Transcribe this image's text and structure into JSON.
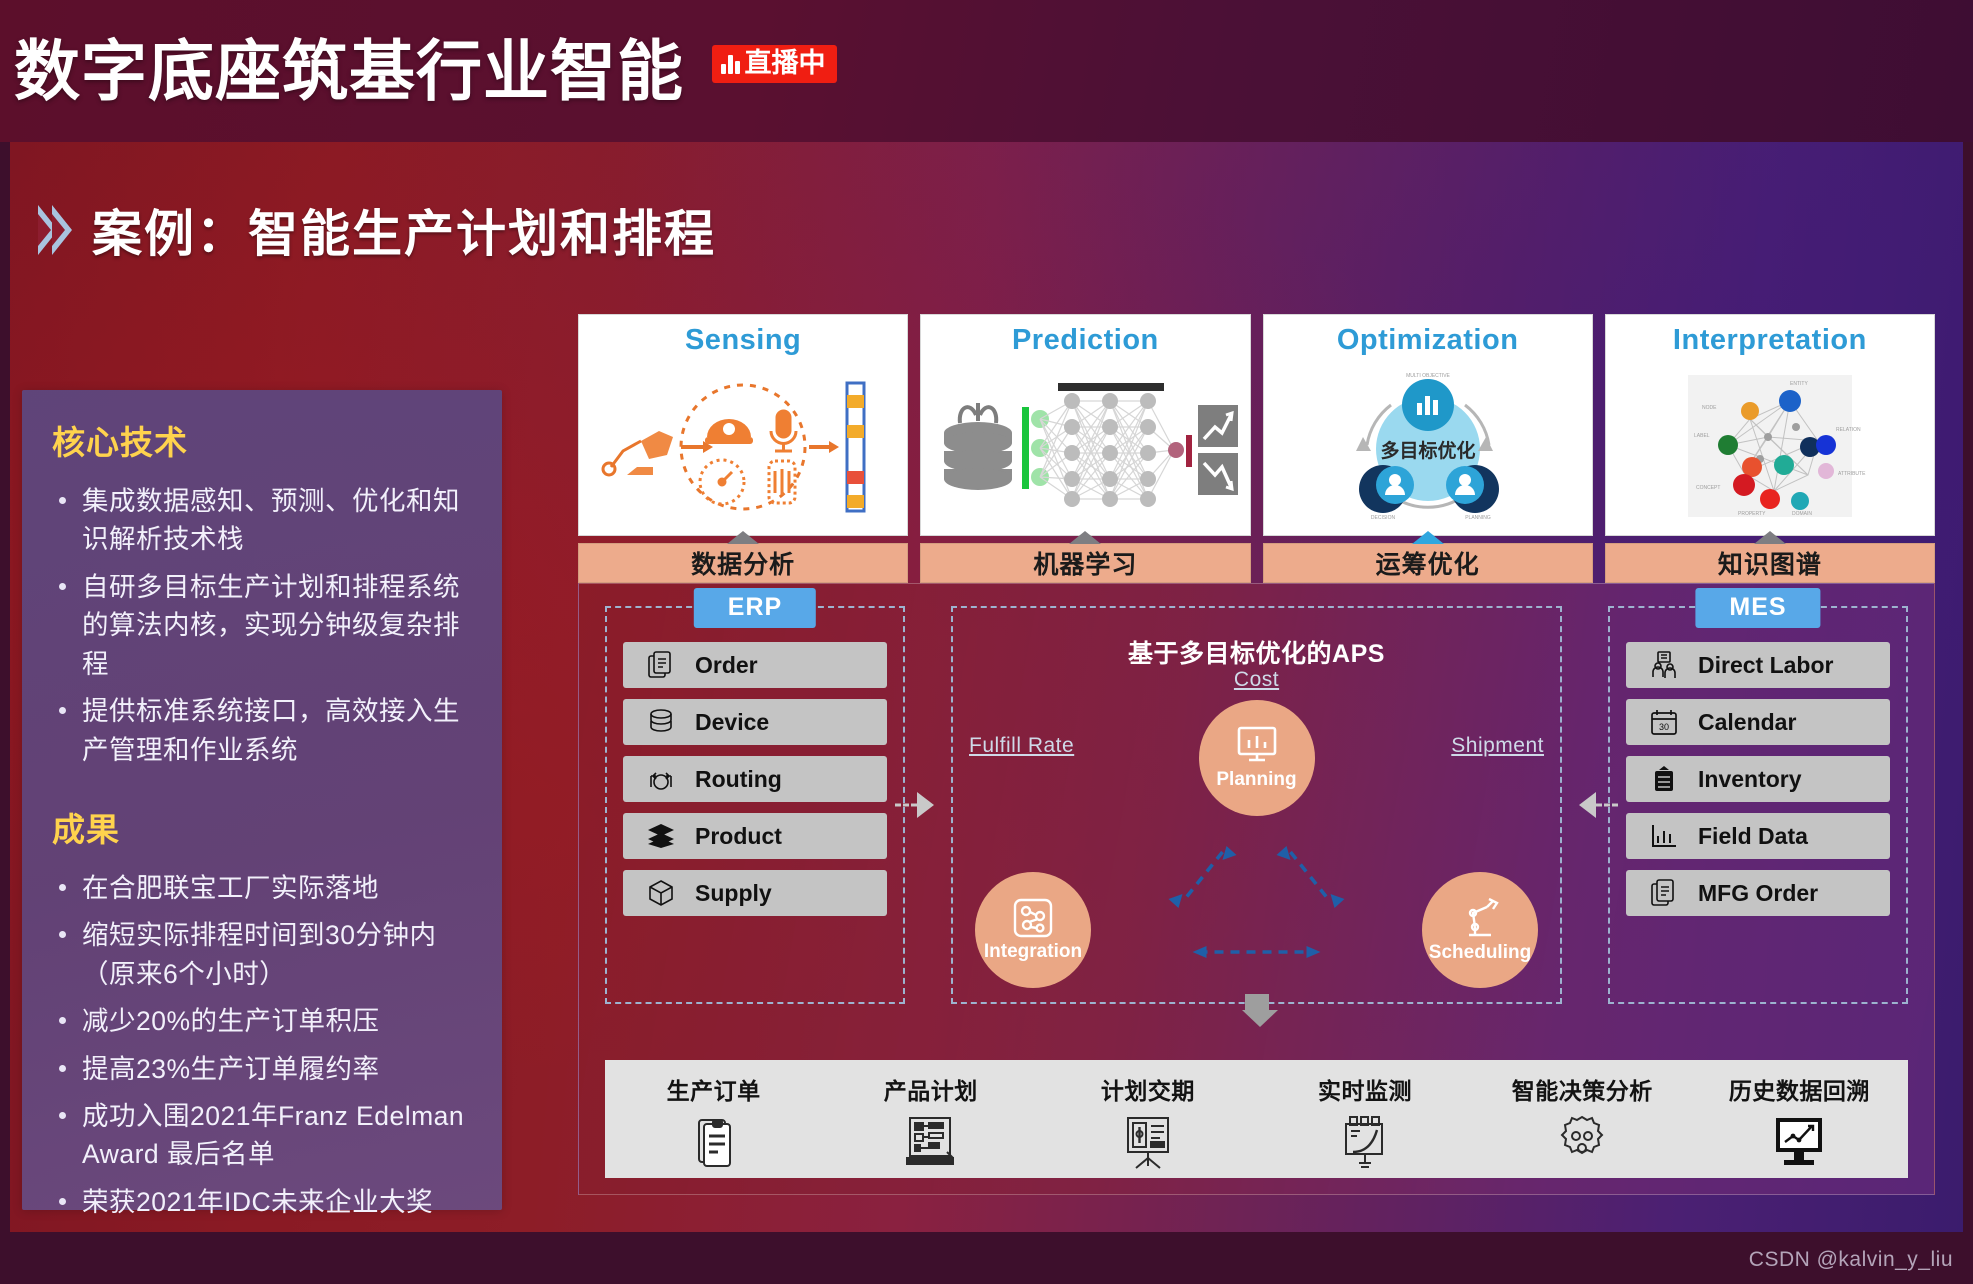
{
  "header": {
    "title": "数字底座筑基行业智能",
    "live_badge": "直播中",
    "live_badge_color": "#f01e12"
  },
  "slide": {
    "heading": "案例：智能生产计划和排程",
    "chevron_color": "#a9c4e0"
  },
  "left_card": {
    "section1_title": "核心技术",
    "section1_items": [
      "集成数据感知、预测、优化和知识解析技术栈",
      "自研多目标生产计划和排程系统的算法内核，实现分钟级复杂排程",
      "提供标准系统接口，高效接入生产管理和作业系统"
    ],
    "section2_title": "成果",
    "section2_items": [
      "在合肥联宝工厂实际落地",
      "缩短实际排程时间到30分钟内（原来6个小时）",
      "减少20%的生产订单积压",
      "提高23%生产订单履约率",
      "成功入围2021年Franz Edelman Award 最后名单",
      "荣获2021年IDC未来企业大奖"
    ],
    "title_color": "#ffd34d"
  },
  "pillars": [
    {
      "title": "Sensing",
      "label": "数据分析",
      "art": "sensing-illustration",
      "accent": false
    },
    {
      "title": "Prediction",
      "label": "机器学习",
      "art": "neural-network-illustration",
      "accent": false
    },
    {
      "title": "Optimization",
      "label": "运筹优化",
      "art": "optimization-illustration",
      "accent": true,
      "art_caption": "多目标优化"
    },
    {
      "title": "Interpretation",
      "label": "知识图谱",
      "art": "knowledge-graph-illustration",
      "accent": false
    }
  ],
  "erp": {
    "tag": "ERP",
    "items": [
      {
        "label": "Order",
        "icon": "document-stack-icon"
      },
      {
        "label": "Device",
        "icon": "database-icon"
      },
      {
        "label": "Routing",
        "icon": "routing-icon"
      },
      {
        "label": "Product",
        "icon": "layers-icon"
      },
      {
        "label": "Supply",
        "icon": "box-icon"
      }
    ]
  },
  "mes": {
    "tag": "MES",
    "items": [
      {
        "label": "Direct Labor",
        "icon": "workers-icon"
      },
      {
        "label": "Calendar",
        "icon": "calendar-30-icon"
      },
      {
        "label": "Inventory",
        "icon": "inventory-icon"
      },
      {
        "label": "Field Data",
        "icon": "bar-chart-icon"
      },
      {
        "label": "MFG Order",
        "icon": "clipboard-icon"
      }
    ]
  },
  "aps": {
    "title": "基于多目标优化的APS",
    "nodes": [
      {
        "id": "planning",
        "label": "Planning",
        "icon": "monitor-chart-icon"
      },
      {
        "id": "integration",
        "label": "Integration",
        "icon": "network-node-icon"
      },
      {
        "id": "scheduling",
        "label": "Scheduling",
        "icon": "robot-arm-icon"
      }
    ],
    "corner_labels": {
      "top": "Cost",
      "left": "Fulfill Rate",
      "right": "Shipment"
    },
    "node_color": "#eaa785"
  },
  "outputs": [
    {
      "label": "生产订单",
      "icon": "clipboard-order-icon"
    },
    {
      "label": "产品计划",
      "icon": "plan-board-icon"
    },
    {
      "label": "计划交期",
      "icon": "flipchart-icon"
    },
    {
      "label": "实时监测",
      "icon": "monitoring-icon"
    },
    {
      "label": "智能决策分析",
      "icon": "gear-analysis-icon"
    },
    {
      "label": "历史数据回溯",
      "icon": "monitor-trend-icon"
    }
  ],
  "watermark": "CSDN @kalvin_y_liu"
}
